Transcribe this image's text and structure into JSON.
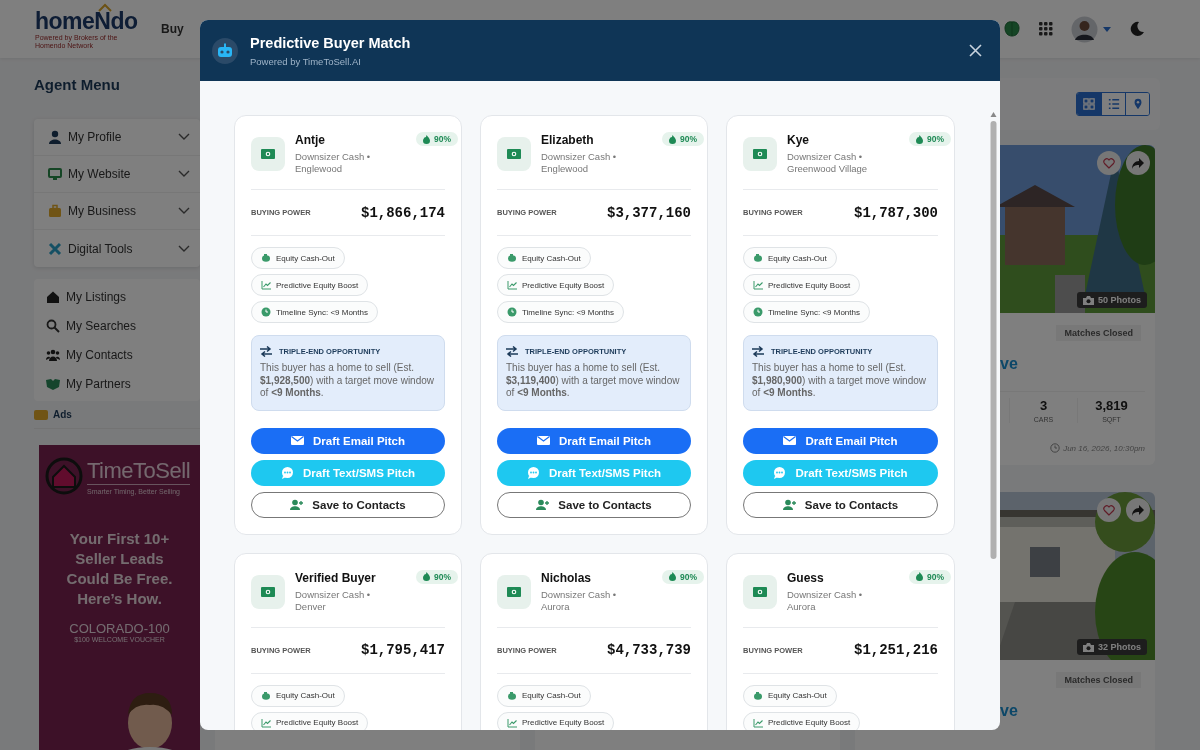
{
  "header": {
    "logo": "homeNdo",
    "logo_tagline": "Powered by Brokers of the Homendo Network",
    "nav": [
      "Buy"
    ]
  },
  "sidebar": {
    "title": "Agent Menu",
    "menu": [
      {
        "kind": "profile",
        "label": "My Profile",
        "expanded": false
      },
      {
        "kind": "website",
        "label": "My Website",
        "expanded": false
      },
      {
        "kind": "business",
        "label": "My Business",
        "expanded": false
      },
      {
        "kind": "tools",
        "label": "Digital Tools",
        "expanded": false
      }
    ],
    "links": [
      {
        "kind": "listings",
        "label": "My Listings"
      },
      {
        "kind": "searches",
        "label": "My Searches"
      },
      {
        "kind": "contacts",
        "label": "My Contacts"
      },
      {
        "kind": "partners",
        "label": "My Partners"
      }
    ],
    "ads_label": "Ads",
    "ad": {
      "brand": "**Time**To**Sell**",
      "tagline": "Smarter Timing, Better Selling",
      "headline": "Your First 10+ Seller Leads Could Be Free. Here’s How.",
      "code": "COLORADO-100",
      "voucher": "$100 WELCOME VOUCHER"
    }
  },
  "main": {
    "view_toggle": [
      {
        "kind": "grid",
        "selected": true
      },
      {
        "kind": "list",
        "selected": false
      },
      {
        "kind": "map",
        "selected": false
      }
    ],
    "listings": [
      {
        "photos": "50 Photos",
        "status": "Matches Closed",
        "title": "ve",
        "stats": [
          {
            "value": "3",
            "label": "CARS"
          },
          {
            "value": "3,819",
            "label": "SQFT"
          }
        ],
        "time": "Jun 16, 2026, 10:30pm"
      },
      {
        "photos": "32 Photos",
        "status": "Matches Closed",
        "title": "ve"
      }
    ]
  },
  "modal": {
    "title": "Predictive Buyer Match",
    "subtitle": "Powered by TimeToSell.AI",
    "buyers": [
      {
        "name": "Antje",
        "segment": "Downsizer Cash • Englewood",
        "score": "90%",
        "power_label": "BUYING POWER",
        "power": "$1,866,174",
        "tags": [
          {
            "kind": "equity",
            "label": "Equity Cash-Out"
          },
          {
            "kind": "boost",
            "label": "Predictive Equity Boost"
          },
          {
            "kind": "timeline",
            "label": "Timeline Sync: <9 Months"
          }
        ],
        "opportunity": {
          "title": "TRIPLE-END OPPORTUNITY",
          "text": "This buyer has a home to sell (Est. **$1,928,500**) with a target move window of **<9 Months**."
        },
        "actions": [
          {
            "kind": "email",
            "label": "Draft Email Pitch"
          },
          {
            "kind": "sms",
            "label": "Draft Text/SMS Pitch"
          },
          {
            "kind": "save",
            "label": "Save to Contacts"
          }
        ]
      },
      {
        "name": "Elizabeth",
        "segment": "Downsizer Cash • Englewood",
        "score": "90%",
        "power_label": "BUYING POWER",
        "power": "$3,377,160",
        "tags": [
          {
            "kind": "equity",
            "label": "Equity Cash-Out"
          },
          {
            "kind": "boost",
            "label": "Predictive Equity Boost"
          },
          {
            "kind": "timeline",
            "label": "Timeline Sync: <9 Months"
          }
        ],
        "opportunity": {
          "title": "TRIPLE-END OPPORTUNITY",
          "text": "This buyer has a home to sell (Est. **$3,119,400**) with a target move window of **<9 Months**."
        },
        "actions": [
          {
            "kind": "email",
            "label": "Draft Email Pitch"
          },
          {
            "kind": "sms",
            "label": "Draft Text/SMS Pitch"
          },
          {
            "kind": "save",
            "label": "Save to Contacts"
          }
        ]
      },
      {
        "name": "Kye",
        "segment": "Downsizer Cash • Greenwood Village",
        "score": "90%",
        "power_label": "BUYING POWER",
        "power": "$1,787,300",
        "tags": [
          {
            "kind": "equity",
            "label": "Equity Cash-Out"
          },
          {
            "kind": "boost",
            "label": "Predictive Equity Boost"
          },
          {
            "kind": "timeline",
            "label": "Timeline Sync: <9 Months"
          }
        ],
        "opportunity": {
          "title": "TRIPLE-END OPPORTUNITY",
          "text": "This buyer has a home to sell (Est. **$1,980,900**) with a target move window of **<9 Months**."
        },
        "actions": [
          {
            "kind": "email",
            "label": "Draft Email Pitch"
          },
          {
            "kind": "sms",
            "label": "Draft Text/SMS Pitch"
          },
          {
            "kind": "save",
            "label": "Save to Contacts"
          }
        ]
      },
      {
        "name": "Verified Buyer",
        "segment": "Downsizer Cash • Denver",
        "score": "90%",
        "power_label": "BUYING POWER",
        "power": "$1,795,417",
        "tags": [
          {
            "kind": "equity",
            "label": "Equity Cash-Out"
          },
          {
            "kind": "boost",
            "label": "Predictive Equity Boost"
          }
        ]
      },
      {
        "name": "Nicholas",
        "segment": "Downsizer Cash • Aurora",
        "score": "90%",
        "power_label": "BUYING POWER",
        "power": "$4,733,739",
        "tags": [
          {
            "kind": "equity",
            "label": "Equity Cash-Out"
          },
          {
            "kind": "boost",
            "label": "Predictive Equity Boost"
          }
        ]
      },
      {
        "name": "Guess",
        "segment": "Downsizer Cash • Aurora",
        "score": "90%",
        "power_label": "BUYING POWER",
        "power": "$1,251,216",
        "tags": [
          {
            "kind": "equity",
            "label": "Equity Cash-Out"
          },
          {
            "kind": "boost",
            "label": "Predictive Equity Boost"
          }
        ]
      }
    ]
  }
}
